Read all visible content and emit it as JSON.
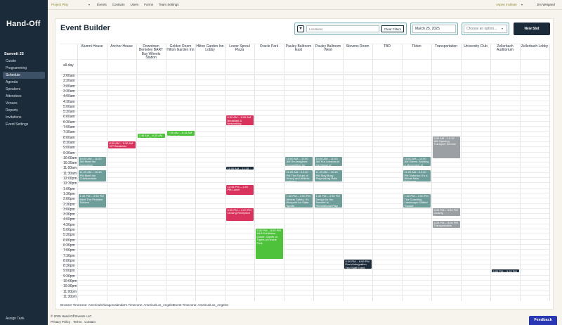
{
  "app": {
    "logo": "Hand-Off"
  },
  "sidebar": {
    "section_title": "Summit 25",
    "items": [
      {
        "label": "Curate",
        "active": false
      },
      {
        "label": "Programming",
        "active": false
      },
      {
        "label": "Schedule",
        "active": true
      },
      {
        "label": "Agenda",
        "active": false
      },
      {
        "label": "Speakers",
        "active": false
      },
      {
        "label": "Attendees",
        "active": false
      },
      {
        "label": "Venues",
        "active": false
      },
      {
        "label": "Reports",
        "active": false
      },
      {
        "label": "Invitations",
        "active": false
      },
      {
        "label": "Event Settings",
        "active": false
      }
    ],
    "footer": "Assign Task"
  },
  "topbar": {
    "project": "Project Play",
    "nav": [
      "Events",
      "Contacts",
      "Users",
      "Forms",
      "Team Settings"
    ],
    "org": "Aspen Institute",
    "user": "Jim Weigand"
  },
  "builder": {
    "title": "Event Builder",
    "locations_placeholder": "Locations",
    "clear_filters": "Clear Filters",
    "date": "March 25, 2025",
    "option_placeholder": "Choose an option...",
    "new_slot": "New Slot"
  },
  "calendar": {
    "allday_label": "all-day",
    "columns": [
      "Alumni House",
      "Anchor House",
      "Downtown Berkeley BART Bay Wheels Station",
      "Golden Room Hilton Garden Inn",
      "Hilton Garden Inn Lobby",
      "Lower Sproul Plaza",
      "Oracle Park",
      "Pauley Ballroom East",
      "Pauley Ballroom West",
      "Stevens Room",
      "TBD",
      "Tilden",
      "Transportation",
      "University Club",
      "Zellerbach Auditorium",
      "Zellerbach Lobby"
    ],
    "times": [
      "2:00am",
      "2:30am",
      "3:00am",
      "3:30am",
      "4:00am",
      "4:30am",
      "5:00am",
      "5:30am",
      "6:00am",
      "6:30am",
      "7:00am",
      "7:30am",
      "8:00am",
      "8:30am",
      "9:00am",
      "9:30am",
      "10:00am",
      "10:30am",
      "11:00am",
      "11:30am",
      "12:00pm",
      "12:30pm",
      "1:00pm",
      "1:30pm",
      "2:00pm",
      "2:30pm",
      "3:00pm",
      "3:30pm",
      "4:00pm",
      "4:30pm",
      "5:00pm",
      "5:30pm",
      "6:00pm",
      "6:30pm",
      "7:00pm",
      "7:30pm",
      "8:00pm",
      "8:30pm",
      "9:00pm",
      "9:30pm",
      "10:00pm",
      "10:30pm",
      "11:00pm",
      "11:30pm"
    ],
    "colors": {
      "teal": "#6f9e9a",
      "red": "#d9325c",
      "green": "#4fc23c",
      "gray": "#9aa0a3",
      "navy": "#1b2b3a"
    },
    "events": [
      {
        "col": 5,
        "start": 6.0,
        "end": 7.0,
        "color": "red",
        "text": "6:00 AM – 6:59 AM Breakfast & Networking"
      },
      {
        "col": 1,
        "start": 8.5,
        "end": 9.25,
        "color": "red",
        "text": "8:30 AM – 9:30 AM VIP Breakfast"
      },
      {
        "col": 2,
        "start": 7.75,
        "end": 8.25,
        "color": "green",
        "text": "7:45 AM – 8:25 AM Summit Shuttle"
      },
      {
        "col": 3,
        "start": 7.5,
        "end": 8.0,
        "color": "green",
        "text": "7:30 AM – 8:14 AM Shuttle Bus"
      },
      {
        "col": 12,
        "start": 8.0,
        "end": 10.25,
        "color": "gray",
        "text": "8:00 AM – 10:15 AM Opening Transport Service"
      },
      {
        "col": 0,
        "start": 10.0,
        "end": 11.0,
        "color": "teal",
        "text": "10:00 AM – 11:00 AM Meet the Innovators"
      },
      {
        "col": 7,
        "start": 10.0,
        "end": 11.0,
        "color": "teal",
        "text": "10:00 AM – 11:00 AM Re-imagined Competition for Opportunity"
      },
      {
        "col": 8,
        "start": 10.0,
        "end": 11.0,
        "color": "teal",
        "text": "10:00 AM – 11:00 AM Ten Lessons in the Game of Leaders"
      },
      {
        "col": 11,
        "start": 10.0,
        "end": 11.0,
        "color": "teal",
        "text": "10:00 AM – 11:00 AM Elders: Building a Movement of Youth"
      },
      {
        "col": 5,
        "start": 11.0,
        "end": 11.25,
        "color": "navy",
        "text": "11:00 AM – 11:15 AM"
      },
      {
        "col": 0,
        "start": 11.33,
        "end": 12.5,
        "color": "teal",
        "text": "11:20 AM – 12:40 PM Meet the Collaborators"
      },
      {
        "col": 7,
        "start": 11.33,
        "end": 12.5,
        "color": "teal",
        "text": "11:20 AM – 12:40 PM The Future of Heavy and Athletic Industry"
      },
      {
        "col": 8,
        "start": 11.33,
        "end": 12.5,
        "color": "teal",
        "text": "11:20 AM – 12:40 PM Stay Busy Playmaking Rolls"
      },
      {
        "col": 11,
        "start": 11.33,
        "end": 12.5,
        "color": "teal",
        "text": "11:20 AM – 12:40 PM Violence: It's a Whole New Ballgame"
      },
      {
        "col": 5,
        "start": 12.75,
        "end": 13.75,
        "color": "red",
        "text": "12:45 PM – 1:45 PM Lunch"
      },
      {
        "col": 0,
        "start": 13.67,
        "end": 15.0,
        "color": "teal",
        "text": "1:40 PM – 2:50 PM Meet The Problem Solvers"
      },
      {
        "col": 7,
        "start": 13.67,
        "end": 15.0,
        "color": "teal",
        "text": "1:40 PM – 2:50 PM Athlete Safety: It's Blueprint for Safer Sports"
      },
      {
        "col": 8,
        "start": 13.67,
        "end": 15.0,
        "color": "teal",
        "text": "1:40 PM – 2:50 PM Design for the Handed to Recreational Play"
      },
      {
        "col": 11,
        "start": 13.67,
        "end": 15.0,
        "color": "teal",
        "text": "1:40 PM – 2:50 PM The Coaching Landscape Shifted Toward"
      },
      {
        "col": 5,
        "start": 15.0,
        "end": 16.33,
        "color": "red",
        "text": "3:00 PM – 4:20 PM Closing Reception"
      },
      {
        "col": 12,
        "start": 15.0,
        "end": 15.83,
        "color": "gray",
        "text": "3:00 PM – 3:50 PM Closing Transportation"
      },
      {
        "col": 12,
        "start": 16.25,
        "end": 17.0,
        "color": "gray",
        "text": "4:15 PM – 5:00 PM Transportation Service to Oracle"
      },
      {
        "col": 6,
        "start": 17.0,
        "end": 20.0,
        "color": "green",
        "text": "5:00 PM – 8:00 PM MLB Exhibition Game: Giants vs Tigers at Oracle Park"
      },
      {
        "col": 9,
        "start": 20.0,
        "end": 21.0,
        "color": "navy",
        "text": "8:00 PM – 8:59 PM Event Integration Test Staff Event"
      },
      {
        "col": 14,
        "start": 21.0,
        "end": 21.25,
        "color": "navy",
        "text": "9:00 PM – 9:15 PM"
      }
    ]
  },
  "timezones": [
    "Browser Timezone: America/Chicago",
    "Calendar's Timezone: America/Los_Angeles",
    "Event Timezone: America/Los_Angeles"
  ],
  "footer": {
    "copyright": "© 2025 Hand-Off Events LLC",
    "links": [
      "Privacy Policy",
      "Terms",
      "Contact"
    ]
  },
  "feedback": "Feedback"
}
